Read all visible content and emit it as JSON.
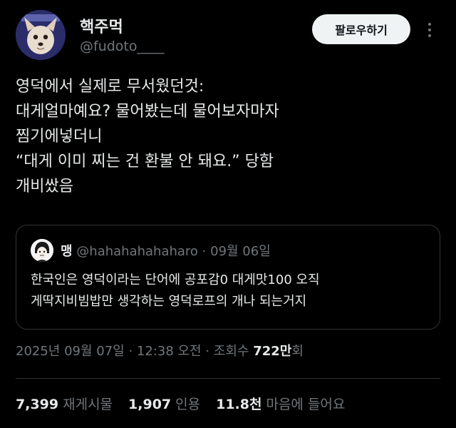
{
  "author": {
    "display_name": "핵주먹",
    "handle": "@fudoto____"
  },
  "follow_button": {
    "label": "팔로우하기"
  },
  "tweet_lines": [
    "영덕에서 실제로 무서웠던것:",
    "대게얼마예요? 물어봤는데 물어보자마자",
    "찜기에넣더니",
    "“대게 이미 찌는 건 환불 안 돼요.” 당함",
    "개비쌌음"
  ],
  "quote": {
    "name": "맹",
    "meta": "@hahahahahaharo · 09월 06일",
    "lines": [
      "한국인은 영덕이라는 단어에 공포감0 대게맛100 오직",
      "게딱지비빔밥만 생각하는 영덕로프의 개나 되는거지"
    ]
  },
  "meta": {
    "timestamp": "2025년 09월 07일 · 12:38 오전 · 조회수 ",
    "views_number": "722만",
    "views_suffix": "회"
  },
  "stats": {
    "reposts_count": "7,399",
    "reposts_label": "재게시물",
    "quotes_count": "1,907",
    "quotes_label": "인용",
    "likes_count": "11.8천",
    "likes_label": "마음에 들어요"
  },
  "icons": {
    "more": "more-vertical-icon"
  },
  "colors": {
    "background": "#000000",
    "text": "#e7e9ea",
    "secondary": "#71767b",
    "border": "#2f3336",
    "button_bg": "#eff3f4"
  }
}
